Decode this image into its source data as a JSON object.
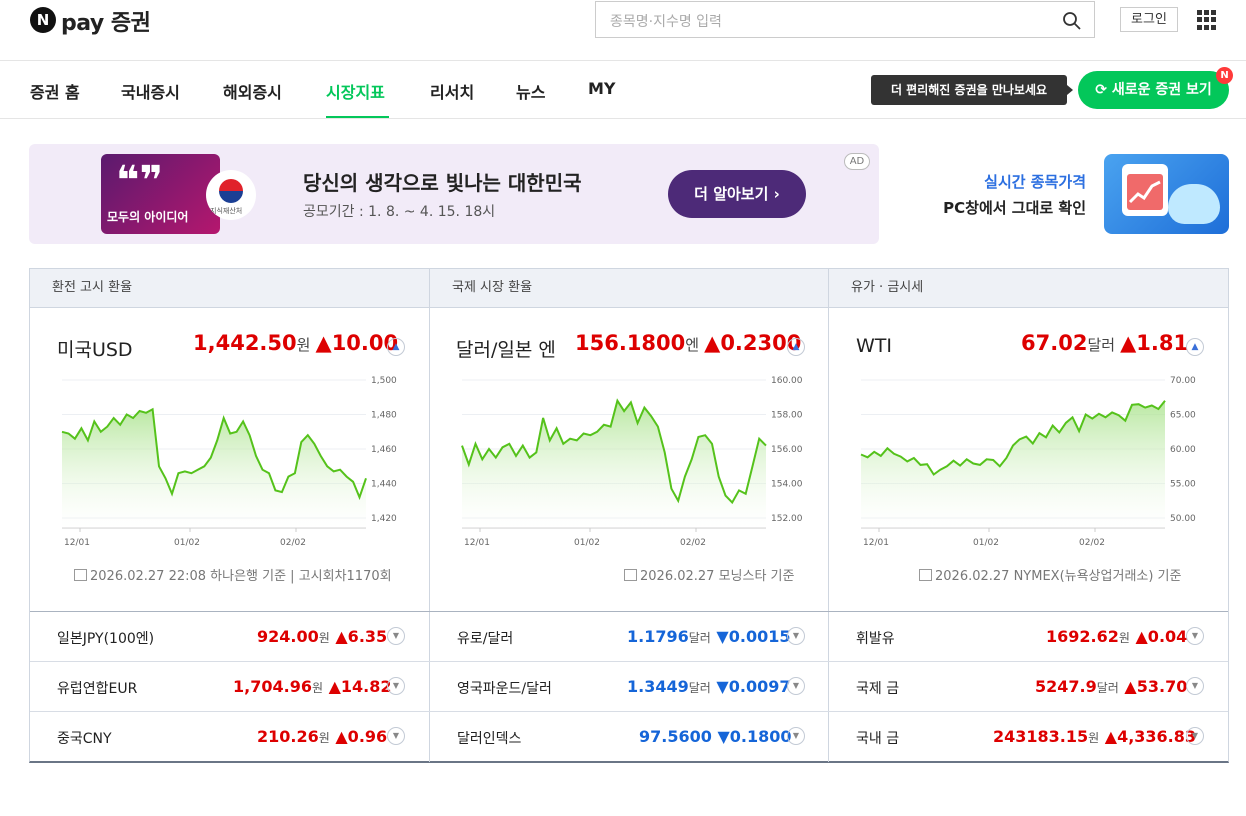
{
  "header": {
    "logo_mark": "N",
    "logo_text": "pay 증권",
    "search_placeholder": "종목명·지수명 입력",
    "login_label": "로그인",
    "search_icon": "search-icon",
    "grid_icon": "apps-grid-icon"
  },
  "nav": {
    "items": [
      "증권 홈",
      "국내증시",
      "해외증시",
      "시장지표",
      "리서치",
      "뉴스",
      "MY"
    ],
    "active": "시장지표",
    "tooltip": "더 편리해진 증권을 만나보세요",
    "new_button": "새로운 증권 보기",
    "badge": "N",
    "accent": "#03c75a"
  },
  "banner": {
    "title": "당신의 생각으로 빛나는 대한민국",
    "subtitle": "공모기간 : 1. 8. ~ 4. 15. 18시",
    "button": "더 알아보기 ›",
    "ad": "AD",
    "image_text": "모두의 아이디어",
    "image_quote": "❝❞",
    "seal_text": "지식재산처"
  },
  "side_promo": {
    "line1": "실시간 종목가격",
    "line2": "PC창에서 그대로 확인"
  },
  "panels": [
    {
      "header": "환전 고시 환율",
      "name": "미국USD",
      "value": "1,442.50",
      "unit": "원",
      "change": "▲10.00",
      "source": "2026.02.27 22:08 하나은행 기준 | 고시회차1170회",
      "rows": [
        {
          "name": "일본JPY(100엔)",
          "value": "924.00",
          "unit": "원",
          "change": "▲6.35",
          "dir": "up"
        },
        {
          "name": "유럽연합EUR",
          "value": "1,704.96",
          "unit": "원",
          "change": "▲14.82",
          "dir": "up"
        },
        {
          "name": "중국CNY",
          "value": "210.26",
          "unit": "원",
          "change": "▲0.96",
          "dir": "up"
        }
      ]
    },
    {
      "header": "국제 시장 환율",
      "name": "달러/일본 엔",
      "value": "156.1800",
      "unit": "엔",
      "change": "▲0.2300",
      "source": "2026.02.27 모닝스타 기준",
      "rows": [
        {
          "name": "유로/달러",
          "value": "1.1796",
          "unit": "달러",
          "change": "▼0.0015",
          "dir": "down"
        },
        {
          "name": "영국파운드/달러",
          "value": "1.3449",
          "unit": "달러",
          "change": "▼0.0097",
          "dir": "down"
        },
        {
          "name": "달러인덱스",
          "value": "97.5600",
          "unit": "",
          "change": "▼0.1800",
          "dir": "down"
        }
      ]
    },
    {
      "header": "유가 · 금시세",
      "name": "WTI",
      "value": "67.02",
      "unit": "달러",
      "change": "▲1.81",
      "source": "2026.02.27 NYMEX(뉴욕상업거래소) 기준",
      "rows": [
        {
          "name": "휘발유",
          "value": "1692.62",
          "unit": "원",
          "change": "▲0.04",
          "dir": "up"
        },
        {
          "name": "국제 금",
          "value": "5247.9",
          "unit": "달러",
          "change": "▲53.70",
          "dir": "up"
        },
        {
          "name": "국내 금",
          "value": "243183.15",
          "unit": "원",
          "change": "▲4,336.83",
          "dir": "up"
        }
      ]
    }
  ],
  "chart_data": [
    {
      "type": "area",
      "x_ticks": [
        "12/01",
        "01/02",
        "02/02"
      ],
      "y_ticks": [
        "1,500",
        "1,480",
        "1,460",
        "1,440",
        "1,420"
      ],
      "ylim": [
        1420,
        1500
      ],
      "values": [
        1470,
        1469,
        1466,
        1472,
        1465,
        1476,
        1470,
        1473,
        1478,
        1474,
        1480,
        1478,
        1482,
        1481,
        1483,
        1450,
        1443,
        1434,
        1446,
        1447,
        1446,
        1448,
        1450,
        1455,
        1465,
        1478,
        1469,
        1470,
        1476,
        1468,
        1456,
        1448,
        1446,
        1436,
        1435,
        1444,
        1446,
        1464,
        1468,
        1463,
        1456,
        1450,
        1447,
        1448,
        1444,
        1441,
        1432,
        1443
      ],
      "color": "#55c21b"
    },
    {
      "type": "area",
      "x_ticks": [
        "12/01",
        "01/02",
        "02/02"
      ],
      "y_ticks": [
        "160.00",
        "158.00",
        "156.00",
        "154.00",
        "152.00"
      ],
      "ylim": [
        152,
        160
      ],
      "values": [
        156.2,
        155.1,
        156.3,
        155.4,
        156.0,
        155.5,
        156.1,
        156.3,
        155.6,
        156.2,
        155.5,
        155.8,
        157.8,
        156.5,
        157.2,
        156.3,
        156.6,
        156.5,
        156.9,
        156.8,
        157.0,
        157.4,
        157.3,
        158.8,
        158.2,
        158.7,
        157.5,
        158.4,
        157.9,
        157.3,
        155.8,
        153.7,
        153.0,
        154.4,
        155.4,
        156.7,
        156.8,
        156.3,
        154.4,
        153.3,
        152.9,
        153.6,
        153.4,
        155.0,
        156.6,
        156.2
      ],
      "color": "#55c21b"
    },
    {
      "type": "area",
      "x_ticks": [
        "12/01",
        "01/02",
        "02/02"
      ],
      "y_ticks": [
        "70.00",
        "65.00",
        "60.00",
        "55.00",
        "50.00"
      ],
      "ylim": [
        50,
        70
      ],
      "values": [
        59.2,
        58.8,
        59.6,
        59.0,
        60.1,
        59.3,
        58.9,
        58.2,
        58.7,
        57.7,
        57.8,
        56.3,
        57.0,
        57.5,
        58.3,
        57.6,
        58.5,
        57.9,
        57.7,
        58.5,
        58.4,
        57.5,
        58.7,
        60.5,
        61.4,
        61.8,
        60.8,
        62.3,
        61.7,
        63.4,
        62.4,
        63.8,
        64.6,
        62.6,
        65.0,
        64.4,
        65.1,
        64.6,
        65.3,
        64.9,
        64.1,
        66.4,
        66.5,
        66.0,
        66.3,
        65.8,
        67.0
      ],
      "color": "#55c21b"
    }
  ]
}
